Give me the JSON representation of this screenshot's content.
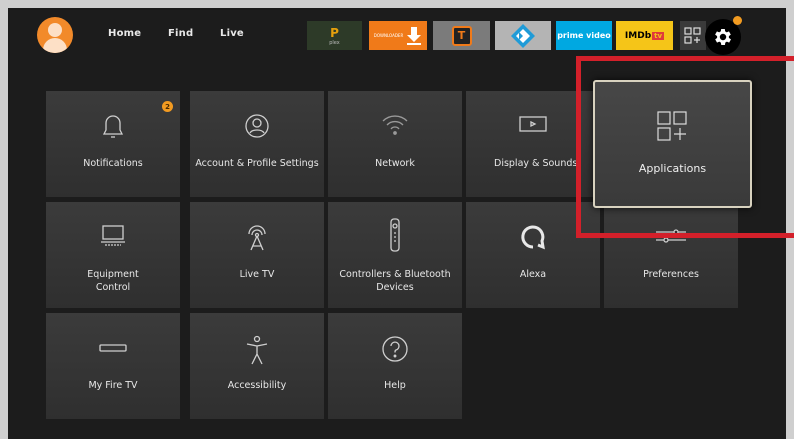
{
  "nav": {
    "home": "Home",
    "find": "Find",
    "live": "Live"
  },
  "apps": [
    {
      "name": "plex",
      "label": "P",
      "sub": "plex"
    },
    {
      "name": "downloader",
      "label": "DOWNLOADER"
    },
    {
      "name": "t-app",
      "label": "T"
    },
    {
      "name": "kodi",
      "label": ""
    },
    {
      "name": "prime-video",
      "label": "prime video"
    },
    {
      "name": "imdb-tv",
      "label": "IMDb",
      "sub": "tv"
    }
  ],
  "settings": {
    "notifications": {
      "label": "Notifications",
      "badge": "2"
    },
    "account": {
      "label": "Account & Profile Settings"
    },
    "network": {
      "label": "Network"
    },
    "display": {
      "label": "Display & Sounds"
    },
    "applications": {
      "label": "Applications"
    },
    "equipment": {
      "label": "Equipment Control"
    },
    "live_tv": {
      "label": "Live TV"
    },
    "controllers": {
      "label": "Controllers & Bluetooth Devices"
    },
    "alexa": {
      "label": "Alexa"
    },
    "preferences": {
      "label": "Preferences"
    },
    "my_fire_tv": {
      "label": "My Fire TV"
    },
    "accessibility": {
      "label": "Accessibility"
    },
    "help": {
      "label": "Help"
    }
  },
  "colors": {
    "accent": "#f29b21",
    "highlight": "#d3202a",
    "imdb": "#f5c518",
    "prime": "#00a8e1"
  }
}
